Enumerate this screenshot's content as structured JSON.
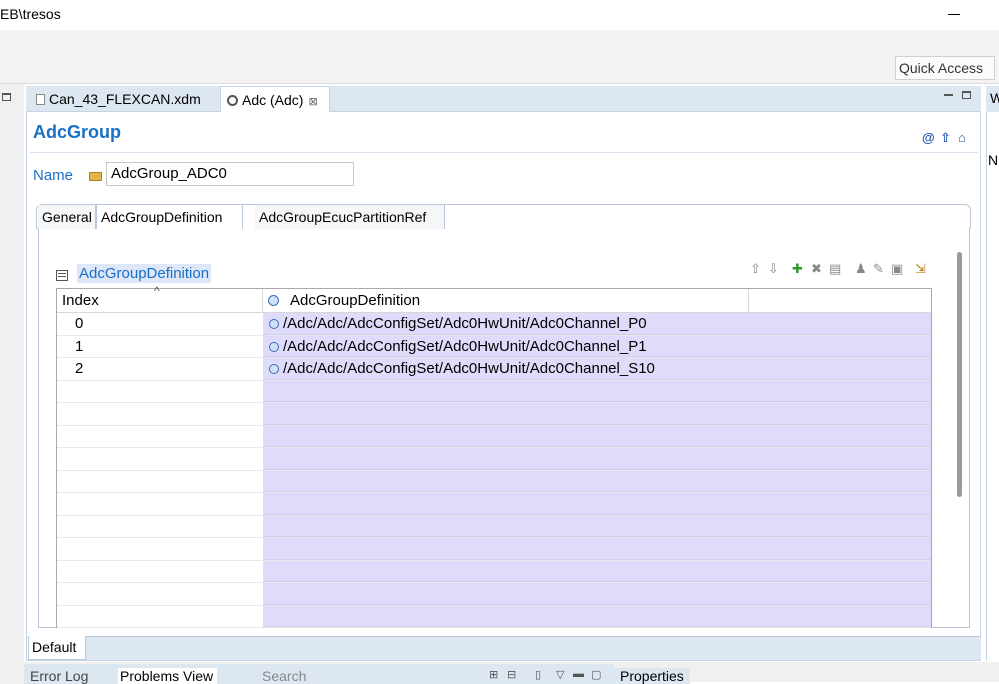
{
  "window": {
    "title": "EB\\tresos"
  },
  "toolbar": {
    "quick_access": "Quick Access"
  },
  "editor_tabs": [
    {
      "label": "Can_43_FLEXCAN.xdm",
      "icon": "document-icon"
    },
    {
      "label": "Adc (Adc)",
      "icon": "module-icon",
      "close": "⊠"
    }
  ],
  "page": {
    "title": "AdcGroup",
    "name_label": "Name",
    "name_value": "AdcGroup_ADC0"
  },
  "inner_tabs": [
    "General",
    "AdcGroupDefinition",
    "AdcGroupEcucPartitionRef"
  ],
  "section": {
    "title": "AdcGroupDefinition"
  },
  "table": {
    "columns": [
      "Index",
      "AdcGroupDefinition"
    ],
    "rows": [
      {
        "index": "0",
        "value": "/Adc/Adc/AdcConfigSet/Adc0HwUnit/Adc0Channel_P0"
      },
      {
        "index": "1",
        "value": "/Adc/Adc/AdcConfigSet/Adc0HwUnit/Adc0Channel_P1"
      },
      {
        "index": "2",
        "value": "/Adc/Adc/AdcConfigSet/Adc0HwUnit/Adc0Channel_S10"
      }
    ]
  },
  "bottom_tab": "Default",
  "bottom_views": [
    "Error Log",
    "Problems View",
    "Search",
    "Properties"
  ],
  "right_view": {
    "tab_letter": "W",
    "label_letter": "N"
  }
}
